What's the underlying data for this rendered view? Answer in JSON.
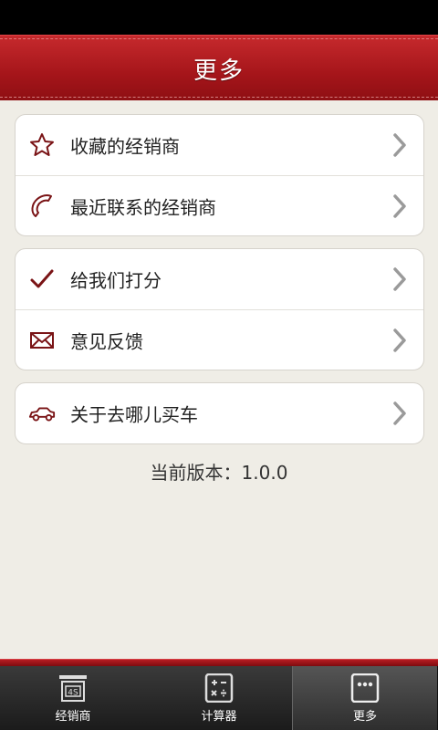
{
  "header": {
    "title": "更多"
  },
  "groups": [
    {
      "items": [
        {
          "label": "收藏的经销商",
          "icon": "star-icon"
        },
        {
          "label": "最近联系的经销商",
          "icon": "phone-icon"
        }
      ]
    },
    {
      "items": [
        {
          "label": "给我们打分",
          "icon": "checkmark-icon"
        },
        {
          "label": "意见反馈",
          "icon": "envelope-icon"
        }
      ]
    },
    {
      "items": [
        {
          "label": "关于去哪儿买车",
          "icon": "car-icon"
        }
      ]
    }
  ],
  "version_text": "当前版本：1.0.0",
  "tabbar": {
    "tabs": [
      {
        "label": "经销商",
        "icon": "dealer-4s-icon",
        "active": false
      },
      {
        "label": "计算器",
        "icon": "calculator-icon",
        "active": false
      },
      {
        "label": "更多",
        "icon": "more-icon",
        "active": true
      }
    ]
  },
  "colors": {
    "brand_red": "#a5151a",
    "icon_red": "#7a1416",
    "background": "#efede6"
  }
}
